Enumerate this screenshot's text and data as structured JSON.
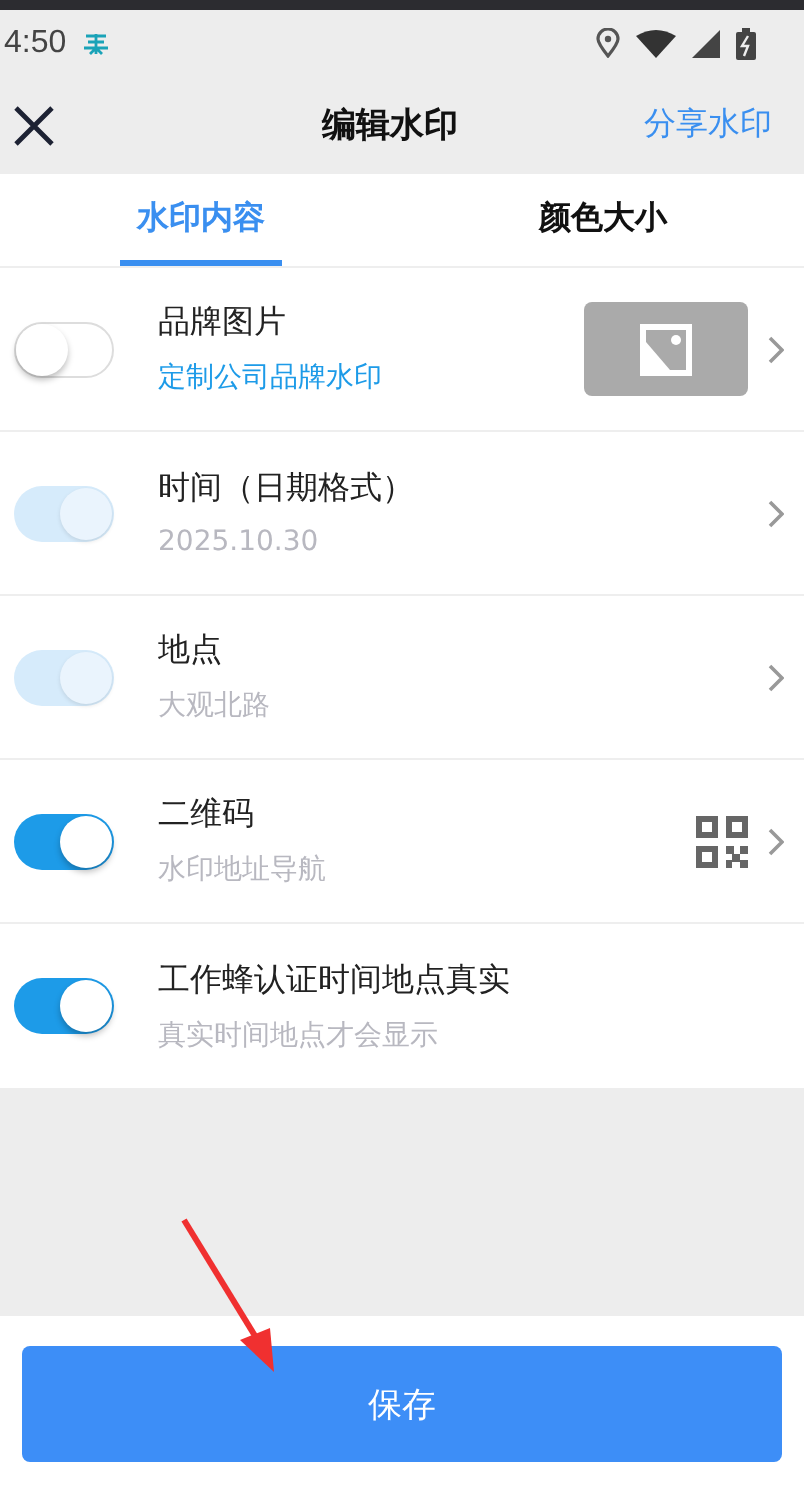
{
  "status_bar": {
    "time": "4:50"
  },
  "header": {
    "title": "编辑水印",
    "action": "分享水印"
  },
  "tabs": [
    {
      "label": "水印内容",
      "selected": true
    },
    {
      "label": "颜色大小",
      "selected": false
    }
  ],
  "rows": [
    {
      "title": "品牌图片",
      "subtitle": "定制公司品牌水印",
      "link": true,
      "on": false,
      "disabled": false,
      "thumbnail": true,
      "qr_code": false,
      "chevron": true
    },
    {
      "title": "时间（日期格式）",
      "subtitle": "2025.10.30",
      "link": false,
      "on": true,
      "disabled": true,
      "thumbnail": false,
      "qr_code": false,
      "chevron": true
    },
    {
      "title": "地点",
      "subtitle": "大观北路",
      "link": false,
      "on": true,
      "disabled": true,
      "thumbnail": false,
      "qr_code": false,
      "chevron": true
    },
    {
      "title": "二维码",
      "subtitle": "水印地址导航",
      "link": false,
      "on": true,
      "disabled": false,
      "thumbnail": false,
      "qr_code": true,
      "chevron": true
    },
    {
      "title": "工作蜂认证时间地点真实",
      "subtitle": "真实时间地点才会显示",
      "link": false,
      "on": true,
      "disabled": false,
      "thumbnail": false,
      "qr_code": false,
      "chevron": false
    }
  ],
  "save_button": "保存"
}
